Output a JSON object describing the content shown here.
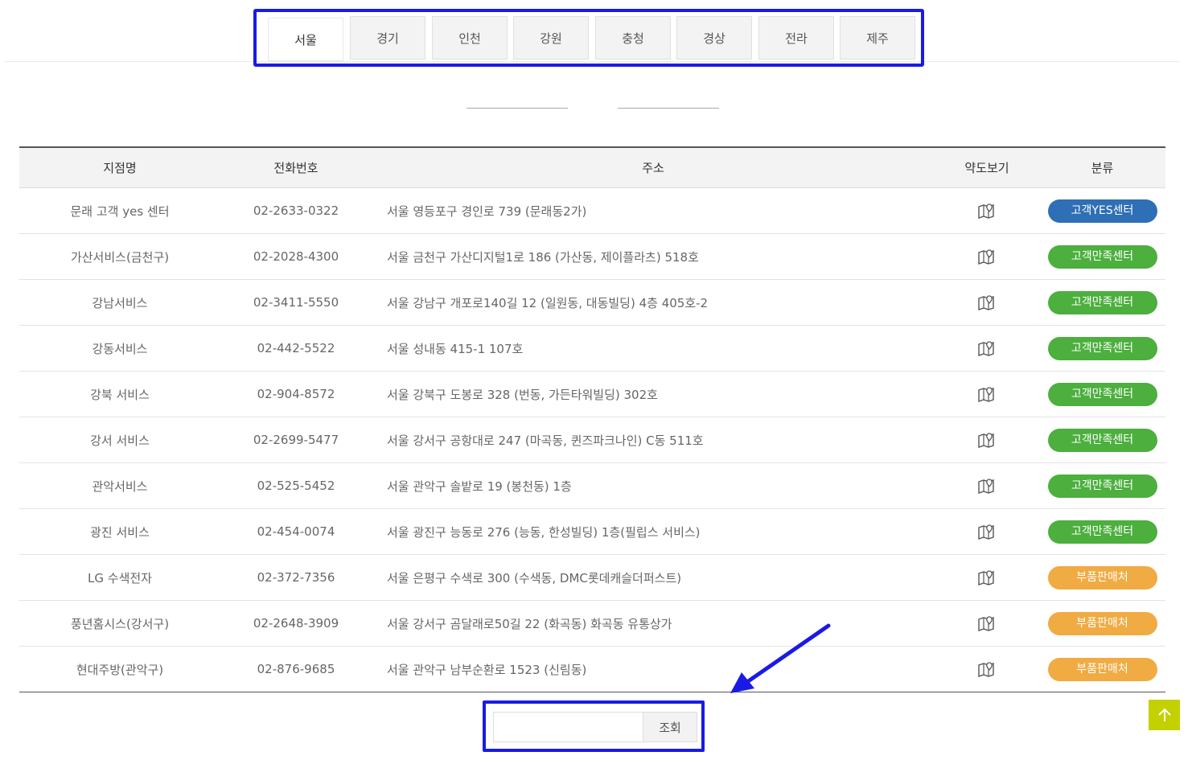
{
  "regions": {
    "active": "서울",
    "tabs": [
      "서울",
      "경기",
      "인천",
      "강원",
      "충청",
      "경상",
      "전라",
      "제주"
    ]
  },
  "table": {
    "headers": [
      "지점명",
      "전화번호",
      "주소",
      "약도보기",
      "분류"
    ],
    "rows": [
      {
        "name": "문래 고객 yes 센터",
        "phone": "02-2633-0322",
        "address": "서울 영등포구 경인로 739 (문래동2가)",
        "category": "고객YES센터",
        "category_color": "blue"
      },
      {
        "name": "가산서비스(금천구)",
        "phone": "02-2028-4300",
        "address": "서울 금천구 가산디지털1로 186 (가산동, 제이플라츠) 518호",
        "category": "고객만족센터",
        "category_color": "green"
      },
      {
        "name": "강남서비스",
        "phone": "02-3411-5550",
        "address": "서울 강남구 개포로140길 12 (일원동, 대동빌딩) 4층 405호-2",
        "category": "고객만족센터",
        "category_color": "green"
      },
      {
        "name": "강동서비스",
        "phone": "02-442-5522",
        "address": "서울 성내동 415-1 107호",
        "category": "고객만족센터",
        "category_color": "green"
      },
      {
        "name": "강북 서비스",
        "phone": "02-904-8572",
        "address": "서울 강북구 도봉로 328 (번동, 가든타워빌딩) 302호",
        "category": "고객만족센터",
        "category_color": "green"
      },
      {
        "name": "강서 서비스",
        "phone": "02-2699-5477",
        "address": "서울 강서구 공항대로 247 (마곡동, 퀸즈파크나인) C동 511호",
        "category": "고객만족센터",
        "category_color": "green"
      },
      {
        "name": "관악서비스",
        "phone": "02-525-5452",
        "address": "서울 관악구 솔밭로 19 (봉천동) 1층",
        "category": "고객만족센터",
        "category_color": "green"
      },
      {
        "name": "광진 서비스",
        "phone": "02-454-0074",
        "address": "서울 광진구 능동로 276 (능동, 한성빌딩) 1층(필립스 서비스)",
        "category": "고객만족센터",
        "category_color": "green"
      },
      {
        "name": "LG 수색전자",
        "phone": "02-372-7356",
        "address": "서울 은평구 수색로 300 (수색동, DMC롯데캐슬더퍼스트)",
        "category": "부품판매처",
        "category_color": "orange"
      },
      {
        "name": "풍년홈시스(강서구)",
        "phone": "02-2648-3909",
        "address": "서울 강서구 곰달래로50길 22 (화곡동) 화곡동 유통상가",
        "category": "부품판매처",
        "category_color": "orange"
      },
      {
        "name": "현대주방(관악구)",
        "phone": "02-876-9685",
        "address": "서울 관악구 남부순환로 1523 (신림동)",
        "category": "부품판매처",
        "category_color": "orange"
      }
    ]
  },
  "search": {
    "value": "",
    "placeholder": "",
    "button_label": "조회"
  },
  "icons": {
    "map": "map-pin-icon",
    "top": "arrow-up-icon",
    "annotation": "annotation-arrow-icon"
  },
  "colors": {
    "annotation": "#1a1ae6",
    "badge_blue": "#2f6fb5",
    "badge_green": "#4caf3e",
    "badge_orange": "#f0ab43",
    "top_button": "#c4d100"
  }
}
